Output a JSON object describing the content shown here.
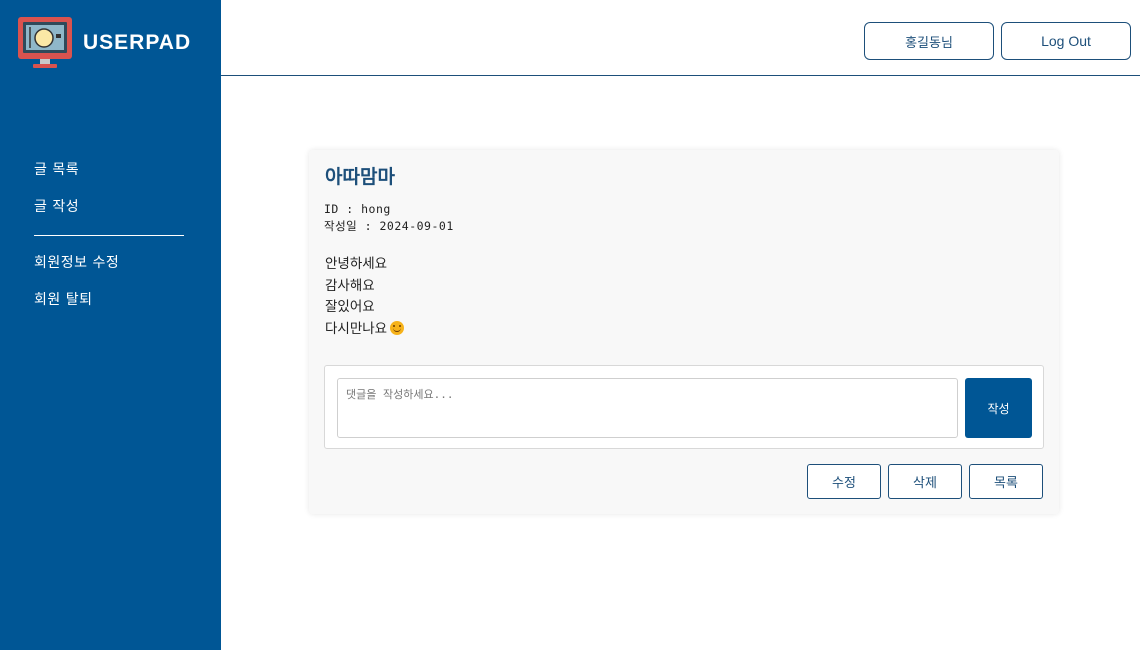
{
  "brand": {
    "name": "USERPAD",
    "icon": "computer-monitor-icon"
  },
  "sidebar": {
    "items": [
      {
        "label": "글 목록"
      },
      {
        "label": "글 작성"
      },
      {
        "label": "회원정보 수정"
      },
      {
        "label": "회원 탈퇴"
      }
    ]
  },
  "header": {
    "user_label": "홍길동님",
    "logout_label": "Log Out"
  },
  "post": {
    "title": "아따맘마",
    "id_line": "ID : hong",
    "date_line": "작성일 : 2024-09-01",
    "lines": [
      "안녕하세요",
      "감사해요",
      "잘있어요",
      "다시만나요"
    ],
    "emoji": "smiling-face-icon"
  },
  "comment": {
    "placeholder": "댓글을 작성하세요...",
    "submit_label": "작성"
  },
  "actions": {
    "edit_label": "수정",
    "delete_label": "삭제",
    "list_label": "목록"
  },
  "colors": {
    "primary": "#005695",
    "accent": "#1d4f7a",
    "card_bg": "#f8f8f8"
  }
}
